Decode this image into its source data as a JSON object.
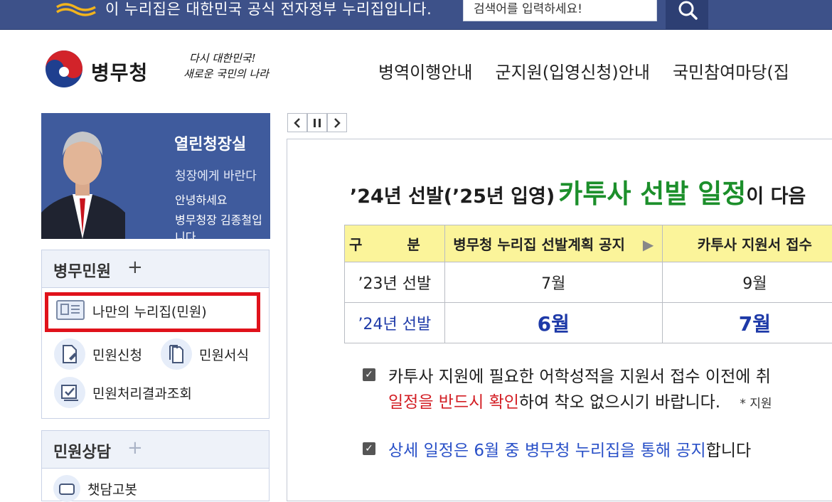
{
  "gov_bar": {
    "notice": "이 누리집은 대한민국 공식 전자정부 누리집입니다.",
    "search_placeholder": "검색어를 입력하세요!"
  },
  "header": {
    "logo_text": "병무청",
    "slogan_line1": "다시 대한민국!",
    "slogan_line2": "새로운 국민의 나라",
    "nav": [
      "병역이행안내",
      "군지원(입영신청)안내",
      "국민참여마당(집"
    ]
  },
  "ceo": {
    "title": "열린청장실",
    "subtitle": "청장에게 바란다",
    "greeting1": "안녕하세요",
    "greeting2": "병무청장 김종철입니다"
  },
  "panel1": {
    "title": "병무민원",
    "plus": "+",
    "items": [
      {
        "label": "나만의 누리집(민원)"
      },
      {
        "label": "민원신청"
      },
      {
        "label": "민원서식"
      },
      {
        "label": "민원처리결과조회"
      }
    ]
  },
  "panel2": {
    "title": "민원상담",
    "plus": "+",
    "items": [
      {
        "label": "챗담고봇"
      }
    ]
  },
  "slider": {
    "headline_a": "’24년 선발(’25년 입영)",
    "headline_b": "카투사 선발 일정",
    "headline_c": "이 다음",
    "table": {
      "headers": [
        "구 분",
        "병무청 누리집 선발계획 공지",
        "▶",
        "카투사 지원서 접수"
      ],
      "rows": [
        {
          "label": "’23년 선발",
          "col1": "7월",
          "col2": "9월"
        },
        {
          "label": "’24년 선발",
          "col1": "6월",
          "col2": "7월"
        }
      ]
    },
    "note1_line1": "카투사 지원에 필요한 어학성적을 지원서 접수 이전에 취",
    "note1_red": "일정을 반드시 확인",
    "note1_rest": "하여 착오 없으시기 바랍니다.",
    "note1_small": "* 지원",
    "note2_blue": "상세 일정은 6월 중 병무청 누리집을 통해 공지",
    "note2_rest": "합니다",
    "check": "✓"
  }
}
